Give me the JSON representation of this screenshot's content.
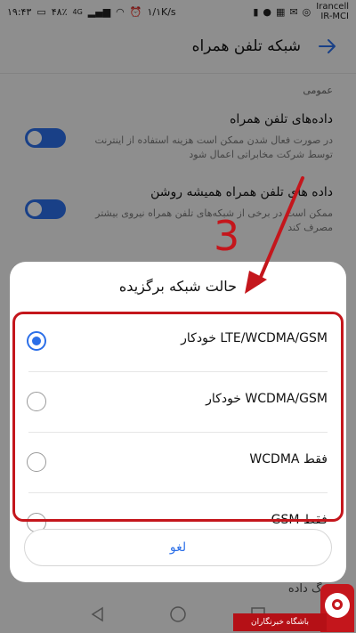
{
  "status_bar": {
    "time": "۱۹:۴۳",
    "battery": "۴۸٪",
    "network_badge": "4G",
    "speed": "۱/۱K/s",
    "carrier_1": "Irancell",
    "carrier_2": "IR-MCI"
  },
  "header": {
    "title": "شبکه تلفن همراه",
    "back_icon": "arrow-right-icon"
  },
  "section": {
    "label": "عمومی"
  },
  "settings": [
    {
      "title": "داده‌های تلفن همراه",
      "description": "در صورت فعال شدن ممکن است هزینه استفاده از اینترنت توسط شرکت مخابراتی اعمال شود",
      "enabled": true
    },
    {
      "title": "داده های تلفن همراه همیشه روشن",
      "description": "ممکن است در برخی از شبکه‌های تلفن همراه نیروی بیشتر مصرف کند",
      "enabled": true
    }
  ],
  "partial_item_text": "...گ داده",
  "dialog": {
    "title": "حالت شبکه برگزیده",
    "options": [
      {
        "label": "LTE/WCDMA/GSM خودکار",
        "selected": true
      },
      {
        "label": "WCDMA/GSM خودکار",
        "selected": false
      },
      {
        "label": "فقط WCDMA",
        "selected": false
      },
      {
        "label": "فقط GSM",
        "selected": false
      }
    ],
    "cancel_label": "لغو"
  },
  "annotation": {
    "step_number": "3",
    "color": "#c4161c"
  },
  "watermark": {
    "text": "باشگاه خبرنگاران"
  },
  "colors": {
    "accent": "#2c6fe8",
    "annotation": "#c4161c"
  }
}
